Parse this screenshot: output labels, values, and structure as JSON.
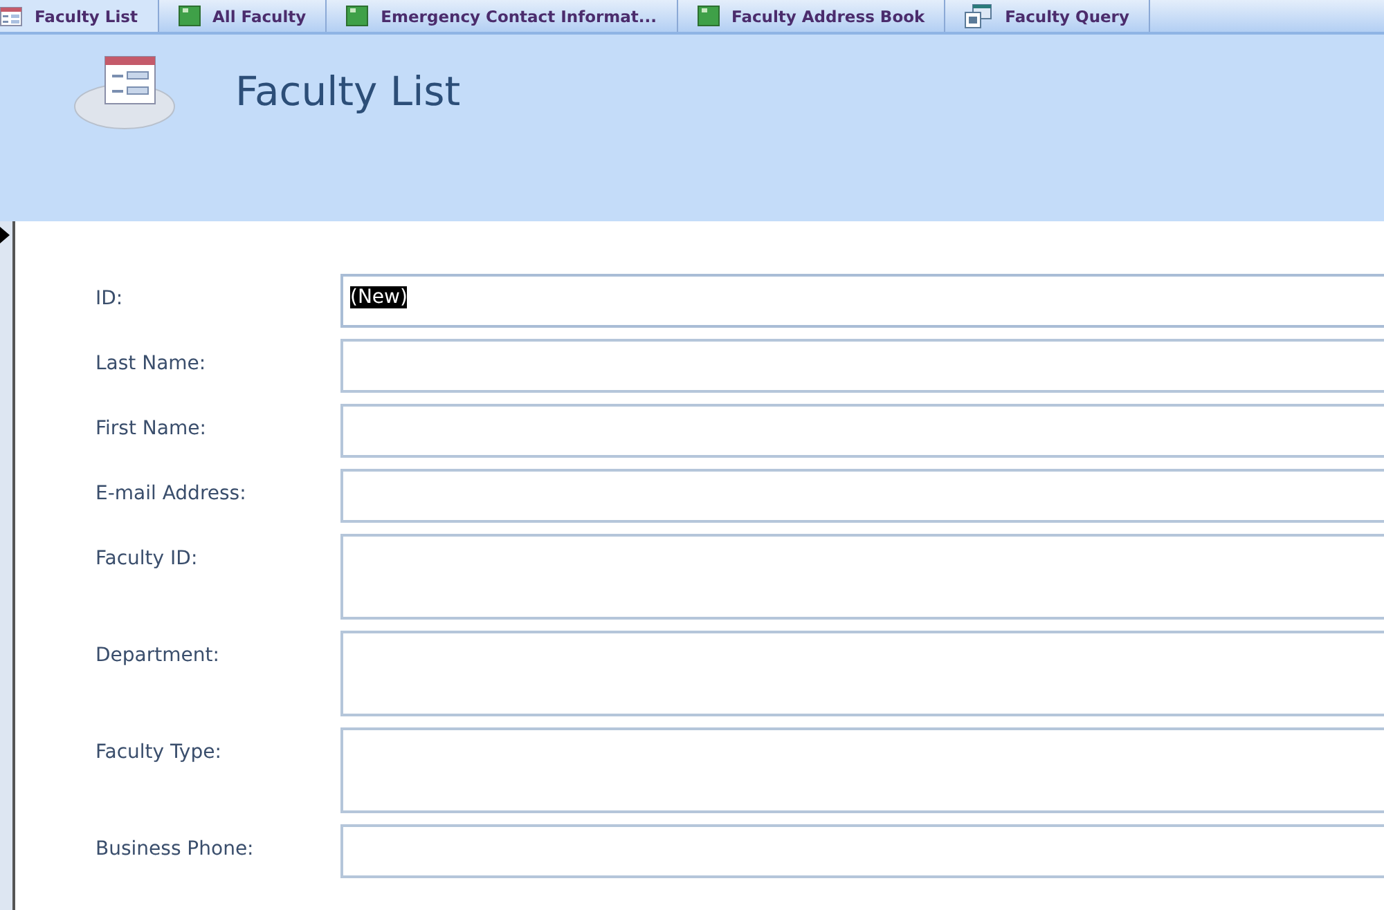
{
  "tabs": [
    {
      "label": "Faculty List",
      "kind": "form",
      "selected": true
    },
    {
      "label": "All Faculty",
      "kind": "table",
      "selected": false
    },
    {
      "label": "Emergency Contact Informat...",
      "kind": "table",
      "selected": false
    },
    {
      "label": "Faculty Address Book",
      "kind": "table",
      "selected": false
    },
    {
      "label": "Faculty Query",
      "kind": "query",
      "selected": false
    }
  ],
  "header": {
    "title": "Faculty List"
  },
  "fields": [
    {
      "label": "ID:",
      "value": "(New)",
      "highlighted": true,
      "kind": "single"
    },
    {
      "label": "Last Name:",
      "kind": "single",
      "highlighted": false
    },
    {
      "label": "First Name:",
      "kind": "single",
      "highlighted": false
    },
    {
      "label": "E-mail Address:",
      "kind": "single",
      "highlighted": false
    },
    {
      "label": "Faculty ID:",
      "kind": "tall",
      "highlighted": false
    },
    {
      "label": "Department:",
      "kind": "tall",
      "highlighted": false
    },
    {
      "label": "Faculty Type:",
      "kind": "tall",
      "highlighted": false
    },
    {
      "label": "Business Phone:",
      "kind": "single",
      "highlighted": false
    }
  ]
}
